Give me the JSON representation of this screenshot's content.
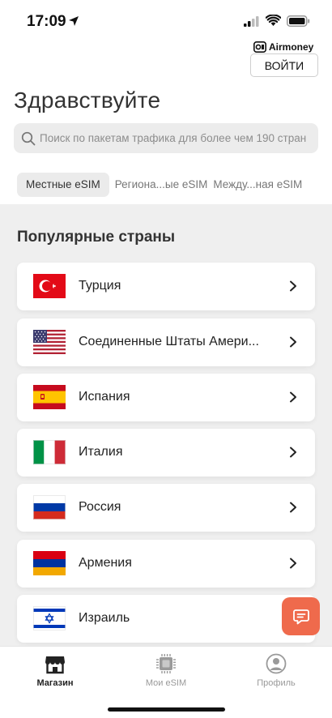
{
  "status_bar": {
    "time": "17:09"
  },
  "brand": {
    "name": "Airmoney"
  },
  "header": {
    "login_label": "ВОЙТИ",
    "greeting": "Здравствуйте"
  },
  "search": {
    "placeholder": "Поиск по пакетам трафика для более чем 190 стран"
  },
  "tabs": [
    {
      "label": "Местные eSIM",
      "active": true
    },
    {
      "label": "Региона...ые eSIM",
      "active": false
    },
    {
      "label": "Между...ная eSIM",
      "active": false
    }
  ],
  "section": {
    "title": "Популярные страны"
  },
  "countries": [
    {
      "name": "Турция",
      "flag": "turkey-flag-icon"
    },
    {
      "name": "Соединенные Штаты Амери...",
      "flag": "usa-flag-icon"
    },
    {
      "name": "Испания",
      "flag": "spain-flag-icon"
    },
    {
      "name": "Италия",
      "flag": "italy-flag-icon"
    },
    {
      "name": "Россия",
      "flag": "russia-flag-icon"
    },
    {
      "name": "Армения",
      "flag": "armenia-flag-icon"
    },
    {
      "name": "Израиль",
      "flag": "israel-flag-icon"
    }
  ],
  "bottom_nav": [
    {
      "label": "Магазин",
      "icon": "store-icon",
      "active": true
    },
    {
      "label": "Мои eSIM",
      "icon": "sim-chip-icon",
      "active": false
    },
    {
      "label": "Профиль",
      "icon": "profile-icon",
      "active": false
    }
  ],
  "colors": {
    "accent": "#ef6a4c",
    "background": "#efefef"
  }
}
